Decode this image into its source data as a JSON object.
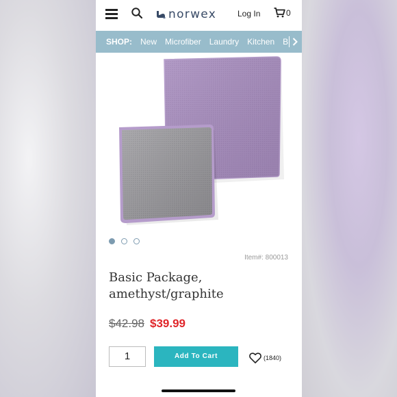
{
  "header": {
    "logo_text": "norwex",
    "login_label": "Log In",
    "cart_count": "0",
    "icons": [
      "menu-icon",
      "search-icon",
      "norwex-logo-mark",
      "cart-icon"
    ]
  },
  "shop_nav": {
    "label": "SHOP:",
    "items": [
      "New",
      "Microfiber",
      "Laundry",
      "Kitchen",
      "B"
    ],
    "more_glyph": ">"
  },
  "carousel": {
    "slide_count": 3,
    "active_index": 0,
    "image_colors": {
      "amethyst": "#a58bbd",
      "graphite": "#9a999c"
    }
  },
  "product": {
    "item_number": "Item#: 800013",
    "title_line1": "Basic Package,",
    "title_line2": "amethyst/graphite",
    "old_price": "$42.98",
    "price": "$39.99",
    "quantity": "1",
    "add_to_cart_label": "Add To Cart",
    "wishlist_count": "(1840)"
  },
  "colors": {
    "nav_bar": "#98bccb",
    "add_to_cart": "#2bb5bf",
    "sale_price": "#e0262a"
  }
}
